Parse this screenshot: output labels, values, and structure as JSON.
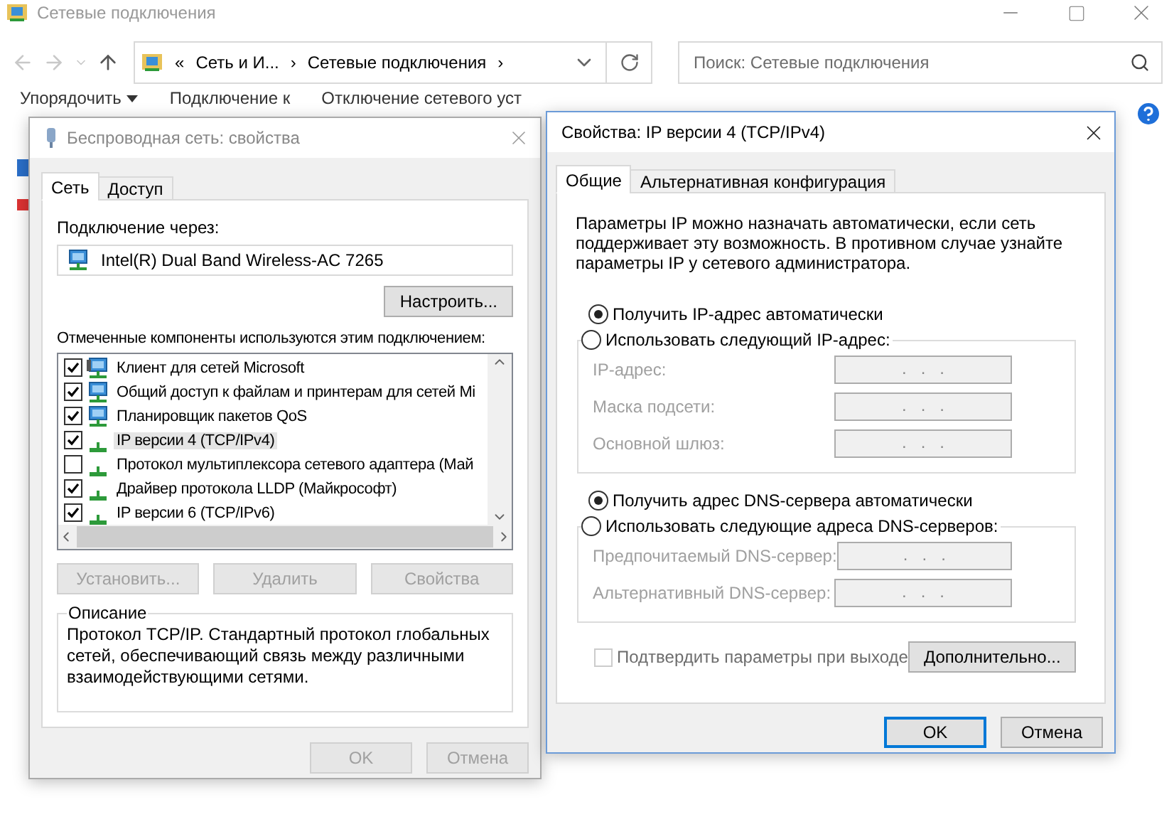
{
  "explorer": {
    "title": "Сетевые подключения",
    "overflow": "«",
    "separator": "›",
    "breadcrumbs": [
      "Сеть и И...",
      "Сетевые подключения"
    ],
    "search": {
      "placeholder": "Поиск: Сетевые подключения"
    },
    "toolbar": [
      "Упорядочить",
      "Подключение к",
      "Отключение сетевого уст"
    ]
  },
  "wireless_dialog": {
    "title": "Беспроводная сеть: свойства",
    "tabs": [
      {
        "label": "Сеть",
        "selected": true
      },
      {
        "label": "Доступ",
        "selected": false
      }
    ],
    "connect_label": "Подключение через:",
    "adapter": "Intel(R) Dual Band Wireless-AC 7265",
    "configure_button": "Настроить...",
    "components_label": "Отмеченные компоненты используются этим подключением:",
    "components": [
      {
        "kind": "client",
        "label": "Клиент для сетей Microsoft",
        "checked": true,
        "selected": false
      },
      {
        "kind": "service",
        "label": "Общий доступ к файлам и принтерам для сетей Mi",
        "checked": true,
        "selected": false
      },
      {
        "kind": "service",
        "label": "Планировщик пакетов QoS",
        "checked": true,
        "selected": false
      },
      {
        "kind": "protocol",
        "label": "IP версии 4 (TCP/IPv4)",
        "checked": true,
        "selected": true
      },
      {
        "kind": "protocol",
        "label": "Протокол мультиплексора сетевого адаптера (Май",
        "checked": false,
        "selected": false
      },
      {
        "kind": "protocol",
        "label": "Драйвер протокола LLDP (Майкрософт)",
        "checked": true,
        "selected": false
      },
      {
        "kind": "protocol",
        "label": "IP версии 6 (TCP/IPv6)",
        "checked": true,
        "selected": false
      }
    ],
    "buttons": [
      {
        "label": "Установить...",
        "disabled": true
      },
      {
        "label": "Удалить",
        "disabled": true
      },
      {
        "label": "Свойства",
        "disabled": true
      }
    ],
    "description": {
      "title": "Описание",
      "text": "Протокол TCP/IP. Стандартный протокол глобальных сетей, обеспечивающий связь между различными взаимодействующими сетями."
    },
    "footer_buttons": [
      {
        "label": "OK",
        "disabled": true
      },
      {
        "label": "Отмена",
        "disabled": true
      }
    ]
  },
  "ipv4_dialog": {
    "title": "Свойства: IP версии 4 (TCP/IPv4)",
    "tabs": [
      {
        "label": "Общие",
        "selected": true
      },
      {
        "label": "Альтернативная конфигурация",
        "selected": false
      }
    ],
    "intro": "Параметры IP можно назначать автоматически, если сеть поддерживает эту возможность. В противном случае узнайте параметры IP у сетевого администратора.",
    "ip_options": [
      {
        "label": "Получить IP-адрес автоматически",
        "selected": true
      },
      {
        "label": "Использовать следующий IP-адрес:",
        "selected": false
      }
    ],
    "ip_fields": [
      {
        "label": "IP-адрес:",
        "value": ".   .   .",
        "disabled": true
      },
      {
        "label": "Маска подсети:",
        "value": ".   .   .",
        "disabled": true
      },
      {
        "label": "Основной шлюз:",
        "value": ".   .   .",
        "disabled": true
      }
    ],
    "dns_options": [
      {
        "label": "Получить адрес DNS-сервера автоматически",
        "selected": true
      },
      {
        "label": "Использовать следующие адреса DNS-серверов:",
        "selected": false
      }
    ],
    "dns_fields": [
      {
        "label": "Предпочитаемый DNS-сервер:",
        "value": ".   .   .",
        "disabled": true
      },
      {
        "label": "Альтернативный DNS-сервер:",
        "value": ".   .   .",
        "disabled": true
      }
    ],
    "validate": {
      "label": "Подтвердить параметры при выходе",
      "checked": false,
      "disabled": true
    },
    "advanced_button": "Дополнительно...",
    "footer_buttons": [
      {
        "label": "OK",
        "default": true
      },
      {
        "label": "Отмена",
        "default": false
      }
    ]
  }
}
